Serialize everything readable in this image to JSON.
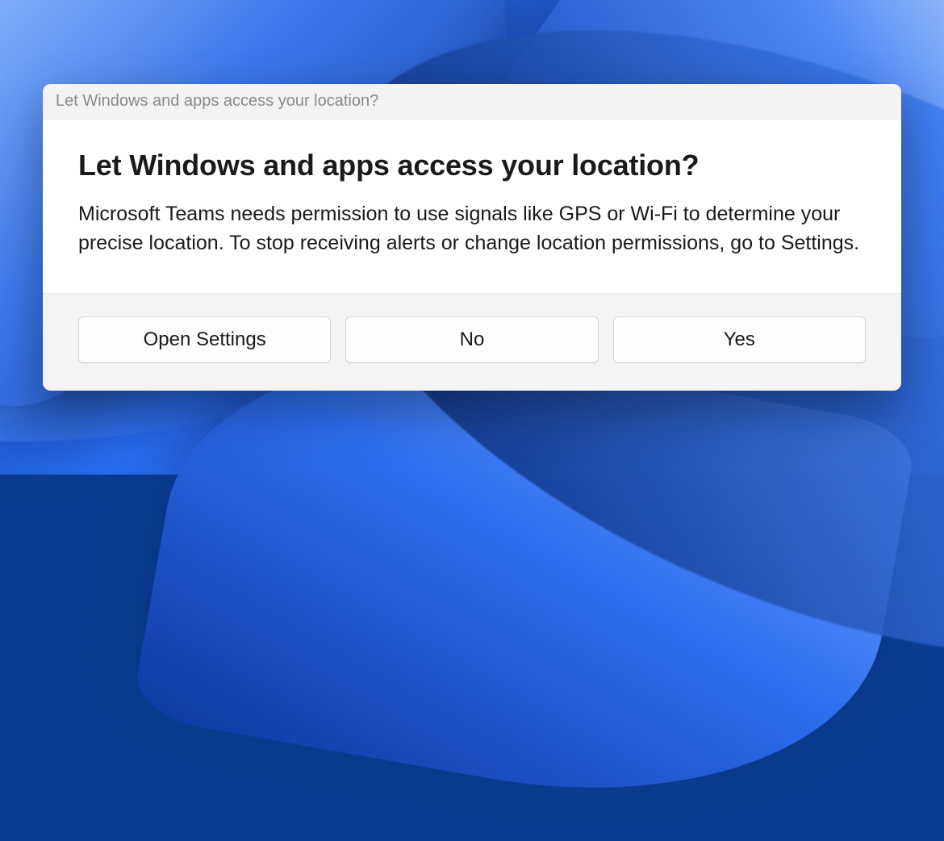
{
  "dialog": {
    "titlebar": "Let Windows and apps access your location?",
    "heading": "Let Windows and apps access your location?",
    "body": "Microsoft Teams needs permission to use signals like GPS or Wi-Fi to determine your precise location. To stop receiving alerts or change location permissions, go to Settings.",
    "buttons": {
      "open_settings": "Open Settings",
      "no": "No",
      "yes": "Yes"
    }
  }
}
